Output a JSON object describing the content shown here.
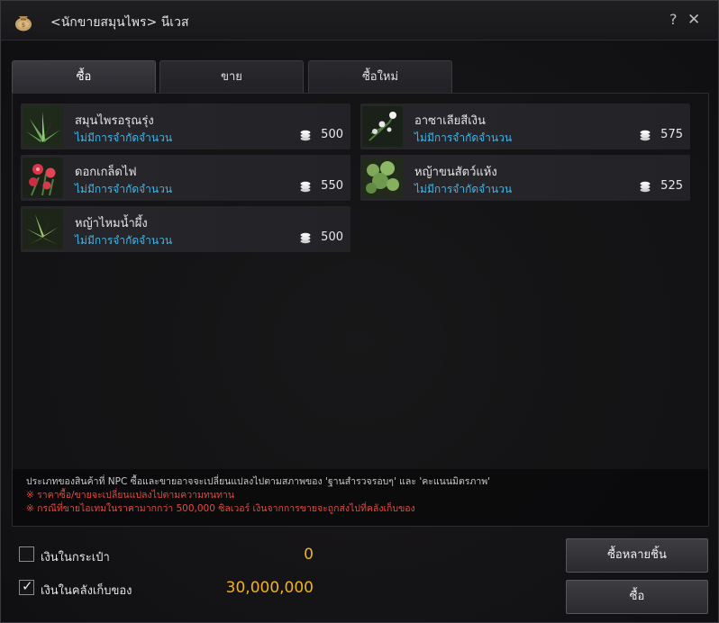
{
  "window": {
    "title": "<นักขายสมุนไพร> นีเวส",
    "help": "?",
    "close": "✕"
  },
  "tabs": [
    {
      "label": "ซื้อ",
      "active": true
    },
    {
      "label": "ขาย",
      "active": false
    },
    {
      "label": "ซื้อใหม่",
      "active": false
    }
  ],
  "items": [
    {
      "name": "สมุนไพรอรุณรุ่ง",
      "limit": "ไม่มีการจำกัดจำนวน",
      "price": "500",
      "icon": "aloe-herb-icon"
    },
    {
      "name": "อาซาเลียสีเงิน",
      "limit": "ไม่มีการจำกัดจำนวน",
      "price": "575",
      "icon": "white-azalea-icon"
    },
    {
      "name": "ดอกเกล็ดไฟ",
      "limit": "ไม่มีการจำกัดจำนวน",
      "price": "550",
      "icon": "red-flower-icon"
    },
    {
      "name": "หญ้าขนสัตว์แห้ง",
      "limit": "ไม่มีการจำกัดจำนวน",
      "price": "525",
      "icon": "dry-grass-icon"
    },
    {
      "name": "หญ้าไหมน้ำผึ้ง",
      "limit": "ไม่มีการจำกัดจำนวน",
      "price": "500",
      "icon": "honey-grass-icon"
    }
  ],
  "notice": {
    "line1": "ประเภทของสินค้าที่ NPC ซื้อและขายอาจจะเปลี่ยนแปลงไปตามสภาพของ 'ฐานสำรวจรอบๆ' และ 'คะแนนมิตรภาพ'",
    "line2": "※ ราคาซื้อ/ขายจะเปลี่ยนแปลงไปตามความทนทาน",
    "line3": "※ กรณีที่ขายไอเทมในราคามากกว่า 500,000 ซิลเวอร์ เงินจากการขายจะถูกส่งไปที่คลังเก็บของ"
  },
  "money": {
    "wallet_label": "เงินในกระเป๋า",
    "wallet_value": "0",
    "wallet_checked": false,
    "storage_label": "เงินในคลังเก็บของ",
    "storage_value": "30,000,000",
    "storage_checked": true
  },
  "buttons": {
    "buy_multiple": "ซื้อหลายชิ้น",
    "buy": "ซื้อ"
  },
  "colors": {
    "limit_text": "#3fb6e8",
    "money_value": "#f0b21c",
    "warning_text": "#e24a3e"
  }
}
